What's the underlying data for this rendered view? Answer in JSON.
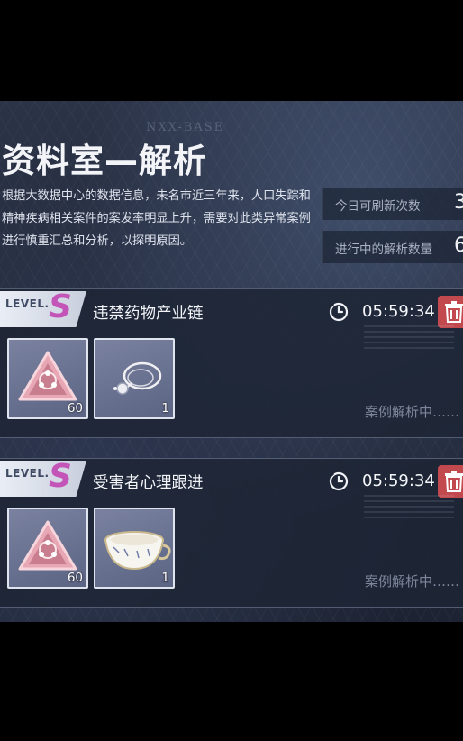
{
  "header": {
    "watermark": "NXX-BASE",
    "title": "资料室—解析",
    "description": "根据大数据中心的数据信息，未名市近三年来，人口失踪和精神疾病相关案件的案发率明显上升，需要对此类异常案例进行慎重汇总和分析，以探明原因。"
  },
  "stats": [
    {
      "label": "今日可刷新次数",
      "value": "3"
    },
    {
      "label": "进行中的解析数量",
      "value": "6"
    }
  ],
  "cases": [
    {
      "level_prefix": "LEVEL.",
      "level": "S",
      "name": "违禁药物产业链",
      "timer": "05:59:34",
      "status": "案例解析中……",
      "items": [
        {
          "icon": "triangle-gem-icon",
          "count": "60"
        },
        {
          "icon": "pendant-necklace-icon",
          "count": "1"
        }
      ]
    },
    {
      "level_prefix": "LEVEL.",
      "level": "S",
      "name": "受害者心理跟进",
      "timer": "05:59:34",
      "status": "案例解析中……",
      "items": [
        {
          "icon": "triangle-gem-icon",
          "count": "60"
        },
        {
          "icon": "teacup-icon",
          "count": "1"
        }
      ]
    }
  ],
  "colors": {
    "accent_level": "#c455b8",
    "delete_button": "#c24a4f",
    "status_text": "#7d869c"
  }
}
